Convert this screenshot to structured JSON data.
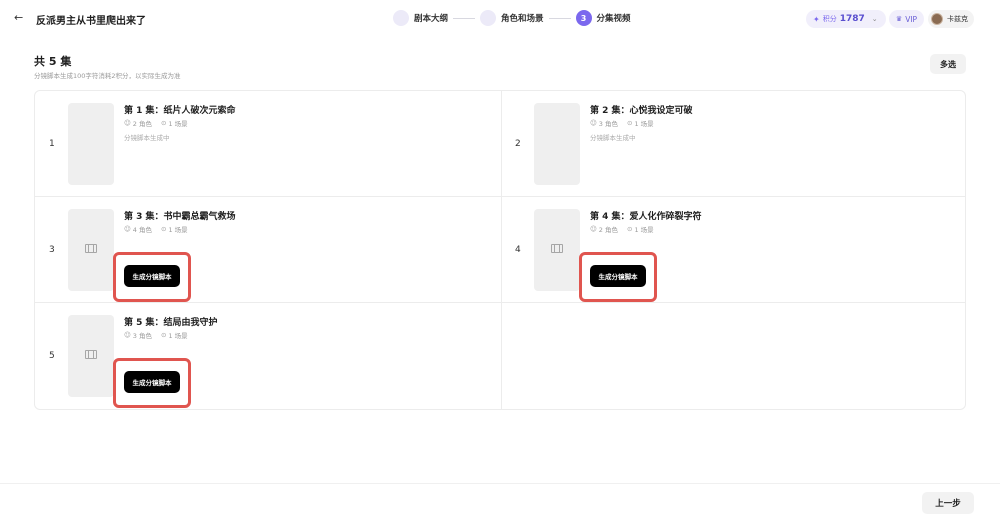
{
  "header": {
    "back_icon": "arrow-left-icon",
    "title": "反派男主从书里爬出来了"
  },
  "steps": [
    {
      "index": "",
      "label": "剧本大纲",
      "active": false
    },
    {
      "index": "",
      "label": "角色和场景",
      "active": false
    },
    {
      "index": "3",
      "label": "分集视频",
      "active": true
    }
  ],
  "account": {
    "points_label": "积分",
    "points_value": "1787",
    "vip_label": "VIP",
    "username": "卡兹克"
  },
  "main": {
    "title": "共 5 集",
    "subtitle": "分镜脚本生成100字符消耗2积分，以实际生成为准",
    "multi_select": "多选",
    "episodes": [
      {
        "number": "1",
        "title": "第 1 集：纸片人破次元索命",
        "roles": "2 角色",
        "scenes": "1 场景",
        "status": "分镜脚本生成中",
        "button": ""
      },
      {
        "number": "2",
        "title": "第 2 集：心悦我设定可破",
        "roles": "3 角色",
        "scenes": "1 场景",
        "status": "分镜脚本生成中",
        "button": ""
      },
      {
        "number": "3",
        "title": "第 3 集：书中霸总霸气救场",
        "roles": "4 角色",
        "scenes": "1 场景",
        "status": "",
        "button": "生成分镜脚本"
      },
      {
        "number": "4",
        "title": "第 4 集：爱人化作碎裂字符",
        "roles": "2 角色",
        "scenes": "1 场景",
        "status": "",
        "button": "生成分镜脚本"
      },
      {
        "number": "5",
        "title": "第 5 集：结局由我守护",
        "roles": "3 角色",
        "scenes": "1 场景",
        "status": "",
        "button": "生成分镜脚本"
      }
    ]
  },
  "footer": {
    "prev_button": "上一步"
  },
  "colors": {
    "accent": "#7b68ee",
    "highlight_box": "#e0554f",
    "button_dark": "#000000"
  }
}
